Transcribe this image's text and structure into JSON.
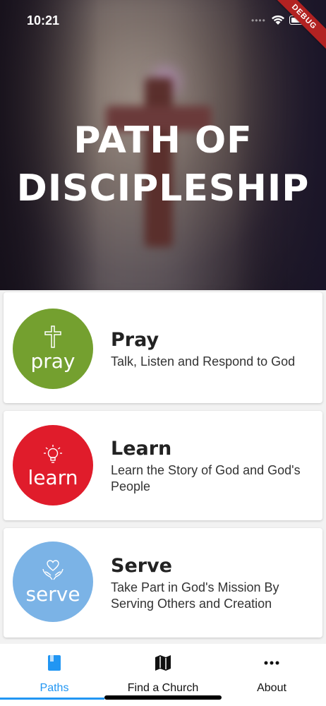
{
  "status_bar": {
    "time": "10:21",
    "debug_label": "DEBUG"
  },
  "hero": {
    "title_line1": "PATH OF",
    "title_line2": "DISCIPLESHIP"
  },
  "paths": [
    {
      "badge_word": "pray",
      "badge_color": "#74a02f",
      "badge_icon": "cross-icon",
      "title": "Pray",
      "description": "Talk, Listen and Respond to God"
    },
    {
      "badge_word": "learn",
      "badge_color": "#e01c2b",
      "badge_icon": "lightbulb-icon",
      "title": "Learn",
      "description": "Learn the Story of God and God's People"
    },
    {
      "badge_word": "serve",
      "badge_color": "#7bb3e6",
      "badge_icon": "heart-hands-icon",
      "title": "Serve",
      "description": "Take Part in God's Mission By Serving Others and Creation"
    }
  ],
  "bottom_nav": {
    "active_color": "#2196f3",
    "items": [
      {
        "label": "Paths",
        "icon": "book-icon",
        "active": true
      },
      {
        "label": "Find a Church",
        "icon": "map-icon",
        "active": false
      },
      {
        "label": "About",
        "icon": "more-horiz-icon",
        "active": false
      }
    ]
  }
}
